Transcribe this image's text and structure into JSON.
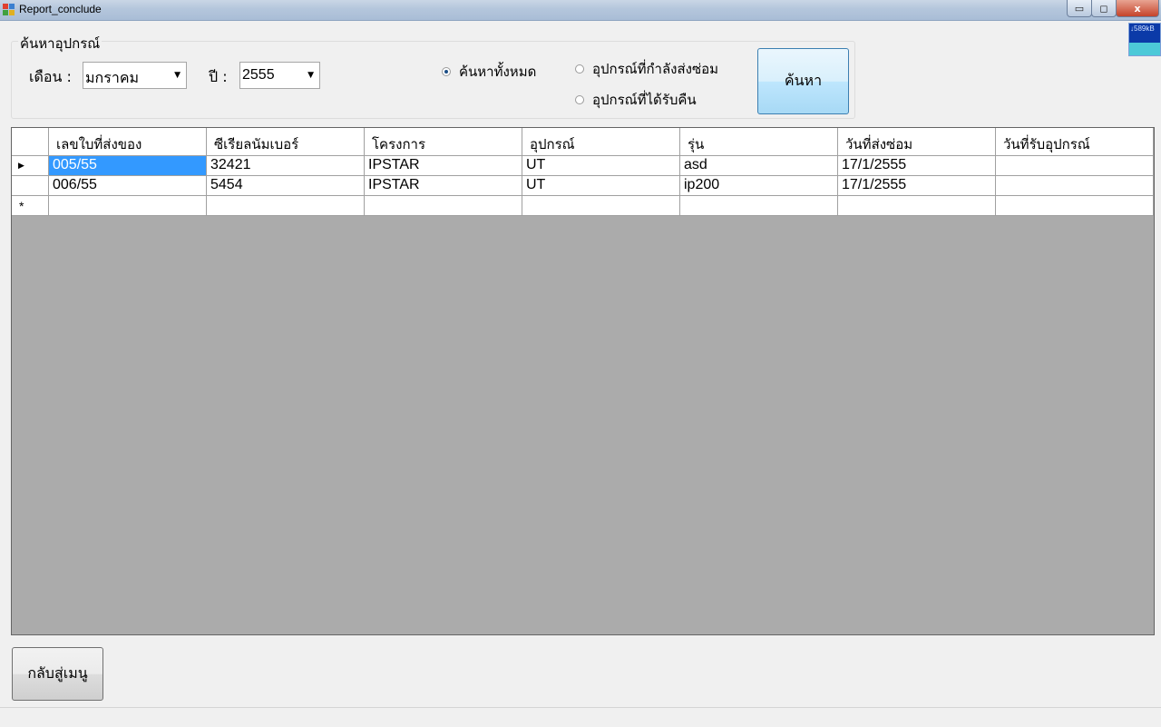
{
  "window": {
    "title": "Report_conclude",
    "close_glyph": "x",
    "min_glyph": "▭",
    "max_glyph": "◻"
  },
  "net_widget": {
    "text": "↓589kB"
  },
  "search_group": {
    "legend": "ค้นหาอุปกรณ์",
    "month_label": "เดือน :",
    "month_value": "มกราคม",
    "year_label": "ปี :",
    "year_value": "2555",
    "radios": [
      {
        "label": "ค้นหาทั้งหมด",
        "checked": true
      },
      {
        "label": "อุปกรณ์ที่กำลังส่งซ่อม",
        "checked": false
      },
      {
        "label": "อุปกรณ์ที่ได้รับคืน",
        "checked": false
      }
    ],
    "search_button": "ค้นหา"
  },
  "grid": {
    "columns": [
      "เลขใบที่ส่งของ",
      "ซีเรียลนัมเบอร์",
      "โครงการ",
      "อุปกรณ์",
      "รุ่น",
      "วันที่ส่งซ่อม",
      "วันที่รับอุปกรณ์"
    ],
    "rows": [
      [
        "005/55",
        "32421",
        "IPSTAR",
        "UT",
        "asd",
        "17/1/2555",
        ""
      ],
      [
        "006/55",
        "5454",
        "IPSTAR",
        "UT",
        "ip200",
        "17/1/2555",
        ""
      ]
    ],
    "current_row_marker": "▶",
    "new_row_marker": "*"
  },
  "footer": {
    "back_button": "กลับสู่เมนู"
  }
}
